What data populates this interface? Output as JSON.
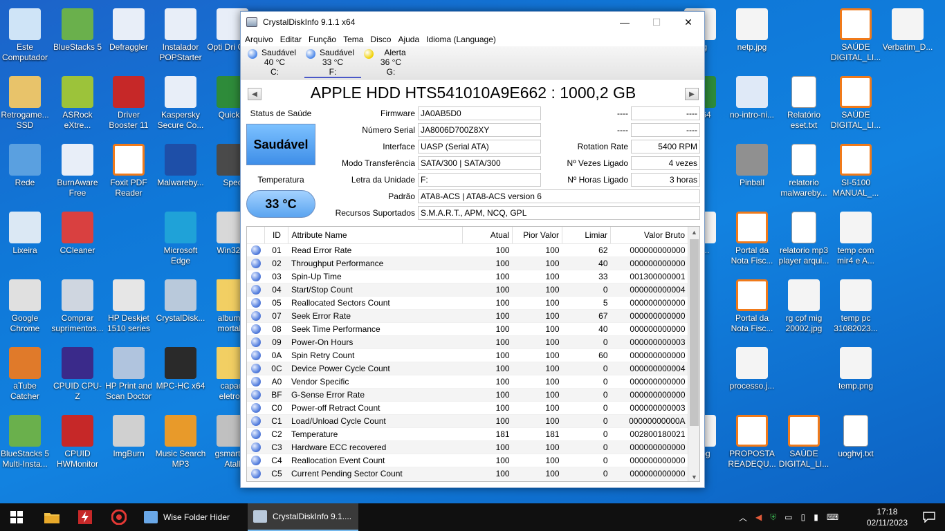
{
  "desktop": {
    "icons": [
      {
        "label": "Este Computador",
        "icon": "computer-icon",
        "color": "#cfe4f7"
      },
      {
        "label": "BlueStacks 5",
        "icon": "bluestacks-icon",
        "color": "#6ab04c"
      },
      {
        "label": "Defraggler",
        "icon": "window-app-icon",
        "color": "#e8eef8"
      },
      {
        "label": "Instalador POPStarter",
        "icon": "window-app-icon",
        "color": "#e8eef8"
      },
      {
        "label": "Opti Dri Contr",
        "icon": "window-app-icon",
        "color": "#e8eef8"
      },
      {
        "label": "Retrogame... SSD",
        "icon": "folder-user-icon",
        "color": "#e8c36a"
      },
      {
        "label": "ASRock eXtre...",
        "icon": "asrock-icon",
        "color": "#9cc33a"
      },
      {
        "label": "Driver Booster 11",
        "icon": "driver-booster-icon",
        "color": "#c62828"
      },
      {
        "label": "Kaspersky Secure Co...",
        "icon": "window-app-icon",
        "color": "#e8eef8"
      },
      {
        "label": "QuickM",
        "icon": "quickm-icon",
        "color": "#2e8b3a"
      },
      {
        "label": "Rede",
        "icon": "network-icon",
        "color": "#5aa0e0"
      },
      {
        "label": "BurnAware Free",
        "icon": "window-app-icon",
        "color": "#e8eef8"
      },
      {
        "label": "Foxit PDF Reader",
        "icon": "pdf-icon",
        "color": "#f07a1a"
      },
      {
        "label": "Malwareby...",
        "icon": "malwarebytes-icon",
        "color": "#1e4fa8"
      },
      {
        "label": "Spec",
        "icon": "speccy-icon",
        "color": "#4a4a4a"
      },
      {
        "label": "Lixeira",
        "icon": "recycle-bin-icon",
        "color": "#dbe8f4"
      },
      {
        "label": "CCleaner",
        "icon": "ccleaner-icon",
        "color": "#d94040"
      },
      {
        "label": "Microsoft Edge",
        "icon": "edge-icon",
        "color": "#1fa2d8"
      },
      {
        "label": "Win32Di",
        "icon": "win32disk-icon",
        "color": "#d8d8d8"
      },
      {
        "label": "Google Chrome",
        "icon": "chrome-icon",
        "color": "#e0e0e0"
      },
      {
        "label": "Comprar suprimentos...",
        "icon": "printer-icon",
        "color": "#cfd6e0"
      },
      {
        "label": "HP Deskjet 1510 series",
        "icon": "printer-icon",
        "color": "#e6e6e6"
      },
      {
        "label": "CrystalDisk...",
        "icon": "crystaldisk-icon",
        "color": "#b9c9db"
      },
      {
        "label": "album a mortal k",
        "icon": "folder-icon",
        "color": "#f2cf63"
      },
      {
        "label": "aTube Catcher",
        "icon": "atube-icon",
        "color": "#e07a2a"
      },
      {
        "label": "CPUID CPU-Z",
        "icon": "cpuz-icon",
        "color": "#3a2a8a"
      },
      {
        "label": "HP Print and Scan Doctor",
        "icon": "hp-icon",
        "color": "#b0c4de"
      },
      {
        "label": "MPC-HC x64",
        "icon": "mpc-icon",
        "color": "#2a2a2a"
      },
      {
        "label": "capaci eletrolit",
        "icon": "folder-icon",
        "color": "#f2cf63"
      },
      {
        "label": "BlueStacks 5 Multi-Insta...",
        "icon": "bluestacks-icon",
        "color": "#6ab04c"
      },
      {
        "label": "CPUID HWMonitor",
        "icon": "hwmonitor-icon",
        "color": "#c62828"
      },
      {
        "label": "ImgBurn",
        "icon": "imgburn-icon",
        "color": "#d0d0d0"
      },
      {
        "label": "Music Search MP3",
        "icon": "music-icon",
        "color": "#e89a2a"
      },
      {
        "label": "gsmarte - Atall",
        "icon": "gsmart-icon",
        "color": "#c0c0c0"
      },
      {
        "label": "peg",
        "icon": "image-icon",
        "color": "#f4f4f4"
      },
      {
        "label": "netp.jpg",
        "icon": "image-icon",
        "color": "#f4f4f4"
      },
      {
        "label": "SAÚDE DIGITAL_LI...",
        "icon": "pdf-icon",
        "color": "#f07a1a"
      },
      {
        "label": "Verbatim_D...",
        "icon": "image-icon",
        "color": "#f4f4f4"
      },
      {
        "label": "C x64",
        "icon": "app-icon",
        "color": "#2e8b3a"
      },
      {
        "label": "no-intro-ni...",
        "icon": "qbittorrent-icon",
        "color": "#dfe9f7"
      },
      {
        "label": "Relatório eset.txt",
        "icon": "text-file-icon",
        "color": "#ffffff"
      },
      {
        "label": "SAÚDE DIGITAL_LI...",
        "icon": "pdf-icon",
        "color": "#f07a1a"
      },
      {
        "label": "Pinball",
        "icon": "pinball-icon",
        "color": "#909090"
      },
      {
        "label": "relatorio malwareby...",
        "icon": "text-file-icon",
        "color": "#ffffff"
      },
      {
        "label": "SI-5100 MANUAL_...",
        "icon": "pdf-icon",
        "color": "#f07a1a"
      },
      {
        "label": "th_...",
        "icon": "image-icon",
        "color": "#f4f4f4"
      },
      {
        "label": "Portal da Nota Fisc...",
        "icon": "pdf-icon",
        "color": "#f07a1a"
      },
      {
        "label": "relatorio mp3 player arqui...",
        "icon": "text-file-icon",
        "color": "#ffffff"
      },
      {
        "label": "temp com mir4 e A...",
        "icon": "image-icon",
        "color": "#f4f4f4"
      },
      {
        "label": "Portal da Nota Fisc...",
        "icon": "pdf-icon",
        "color": "#f07a1a"
      },
      {
        "label": "rg cpf mig 20002.jpg",
        "icon": "image-icon",
        "color": "#f4f4f4"
      },
      {
        "label": "temp pc 31082023...",
        "icon": "image-icon",
        "color": "#f4f4f4"
      },
      {
        "label": "processo.j...",
        "icon": "image-icon",
        "color": "#f4f4f4"
      },
      {
        "label": "temp.png",
        "icon": "image-icon",
        "color": "#f4f4f4"
      },
      {
        "label": "o .jpg",
        "icon": "image-icon",
        "color": "#f4f4f4"
      },
      {
        "label": "PROPOSTA READEQU...",
        "icon": "pdf-icon",
        "color": "#f07a1a"
      },
      {
        "label": "SAÚDE DIGITAL_LI...",
        "icon": "pdf-icon",
        "color": "#f07a1a"
      },
      {
        "label": "uoghvj.txt",
        "icon": "text-file-icon",
        "color": "#ffffff"
      }
    ]
  },
  "window": {
    "title": "CrystalDiskInfo 9.1.1 x64",
    "minimize": "—",
    "maximize": "☐",
    "close": "✕",
    "menu": [
      "Arquivo",
      "Editar",
      "Função",
      "Tema",
      "Disco",
      "Ajuda",
      "Idioma (Language)"
    ],
    "disks": [
      {
        "status": "Saudável",
        "temp": "40 °C",
        "letter": "C:",
        "color": "#4a86e8"
      },
      {
        "status": "Saudável",
        "temp": "33 °C",
        "letter": "F:",
        "color": "#4a86e8"
      },
      {
        "status": "Alerta",
        "temp": "36 °C",
        "letter": "G:",
        "color": "#f0d000"
      }
    ],
    "prev_arrow": "◀",
    "next_arrow": "▶",
    "model": "APPLE HDD HTS541010A9E662 : 1000,2 GB",
    "health_label": "Status de Saúde",
    "health_value": "Saudável",
    "temp_label": "Temperatura",
    "temp_value": "33 °C",
    "info": {
      "firmware_label": "Firmware",
      "firmware": "JA0AB5D0",
      "serial_label": "Número Serial",
      "serial": "JA8006D700Z8XY",
      "interface_label": "Interface",
      "interface": "UASP (Serial ATA)",
      "transfer_label": "Modo Transferência",
      "transfer": "SATA/300 | SATA/300",
      "drive_label": "Letra da Unidade",
      "drive": "F:",
      "standard_label": "Padrão",
      "standard": "ATA8-ACS | ATA8-ACS version 6",
      "features_label": "Recursos Suportados",
      "features": "S.M.A.R.T., APM, NCQ, GPL",
      "r1_label": "----",
      "r1": "----",
      "r2_label": "----",
      "r2": "----",
      "rotation_label": "Rotation Rate",
      "rotation": "5400 RPM",
      "poweron_count_label": "Nº Vezes Ligado",
      "poweron_count": "4 vezes",
      "poweron_hours_label": "Nº Horas Ligado",
      "poweron_hours": "3 horas"
    },
    "smart_headers": [
      "ID",
      "Attribute Name",
      "Atual",
      "Pior Valor",
      "Limiar",
      "Valor Bruto"
    ],
    "smart_rows": [
      [
        "01",
        "Read Error Rate",
        "100",
        "100",
        "62",
        "000000000000"
      ],
      [
        "02",
        "Throughput Performance",
        "100",
        "100",
        "40",
        "000000000000"
      ],
      [
        "03",
        "Spin-Up Time",
        "100",
        "100",
        "33",
        "001300000001"
      ],
      [
        "04",
        "Start/Stop Count",
        "100",
        "100",
        "0",
        "000000000004"
      ],
      [
        "05",
        "Reallocated Sectors Count",
        "100",
        "100",
        "5",
        "000000000000"
      ],
      [
        "07",
        "Seek Error Rate",
        "100",
        "100",
        "67",
        "000000000000"
      ],
      [
        "08",
        "Seek Time Performance",
        "100",
        "100",
        "40",
        "000000000000"
      ],
      [
        "09",
        "Power-On Hours",
        "100",
        "100",
        "0",
        "000000000003"
      ],
      [
        "0A",
        "Spin Retry Count",
        "100",
        "100",
        "60",
        "000000000000"
      ],
      [
        "0C",
        "Device Power Cycle Count",
        "100",
        "100",
        "0",
        "000000000004"
      ],
      [
        "A0",
        "Vendor Specific",
        "100",
        "100",
        "0",
        "000000000000"
      ],
      [
        "BF",
        "G-Sense Error Rate",
        "100",
        "100",
        "0",
        "000000000000"
      ],
      [
        "C0",
        "Power-off Retract Count",
        "100",
        "100",
        "0",
        "000000000003"
      ],
      [
        "C1",
        "Load/Unload Cycle Count",
        "100",
        "100",
        "0",
        "00000000000A"
      ],
      [
        "C2",
        "Temperature",
        "181",
        "181",
        "0",
        "002800180021"
      ],
      [
        "C3",
        "Hardware ECC recovered",
        "100",
        "100",
        "0",
        "000000000000"
      ],
      [
        "C4",
        "Reallocation Event Count",
        "100",
        "100",
        "0",
        "000000000000"
      ],
      [
        "C5",
        "Current Pending Sector Count",
        "100",
        "100",
        "0",
        "000000000000"
      ]
    ]
  },
  "taskbar": {
    "tasks": [
      {
        "label": "Wise Folder Hider",
        "color": "#6aa8e8"
      },
      {
        "label": "CrystalDiskInfo 9.1....",
        "color": "#b9c9db"
      }
    ],
    "time": "17:18",
    "date": "02/11/2023"
  },
  "colors": {
    "accent": "#4a58c8",
    "desktop": "#1282e0"
  }
}
